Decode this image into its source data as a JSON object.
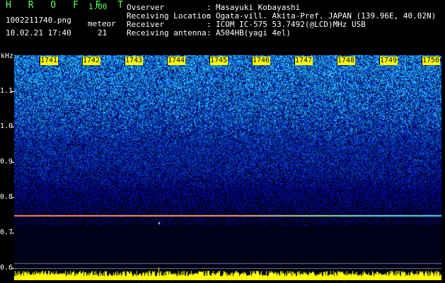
{
  "header": {
    "brand": "H R O F F T",
    "version": "1.00",
    "filename": "1002211740.png",
    "meteor_label": "meteor",
    "datetime": "10.02.21 17:40",
    "meteor_count": "21"
  },
  "info": [
    {
      "key": "Ovserver",
      "value": "Masayuki Kobayashi"
    },
    {
      "key": "Receiving Location",
      "value": "Ogata-vill. Akita-Pref. JAPAN (139.96E, 40.02N)"
    },
    {
      "key": "Receiver",
      "value": "ICOM IC-575 53.7492(@LCD)MHz USB"
    },
    {
      "key": "Receiving antenna",
      "value": "A504HB(yagi 4el)"
    }
  ],
  "colon": ":",
  "spectrogram": {
    "y_unit": "kHz",
    "y_ticks": [
      "1.1",
      "1.0",
      "0.9",
      "0.8",
      "0.7",
      "0.6"
    ],
    "y_range": [
      0.6,
      1.18
    ],
    "time_ticks": [
      "1741",
      "1742",
      "1743",
      "1744",
      "1745",
      "1746",
      "1747",
      "1748",
      "1749",
      "1750"
    ],
    "signal_khz": 0.75,
    "colors": {
      "background": "#000018",
      "noise_low": "#0a1ab0",
      "noise_high": "#2fb0ff",
      "carrier": "#ff6a3a",
      "bottom_bar": "#ffff00",
      "time_tick_bg": "#ffff00"
    }
  }
}
